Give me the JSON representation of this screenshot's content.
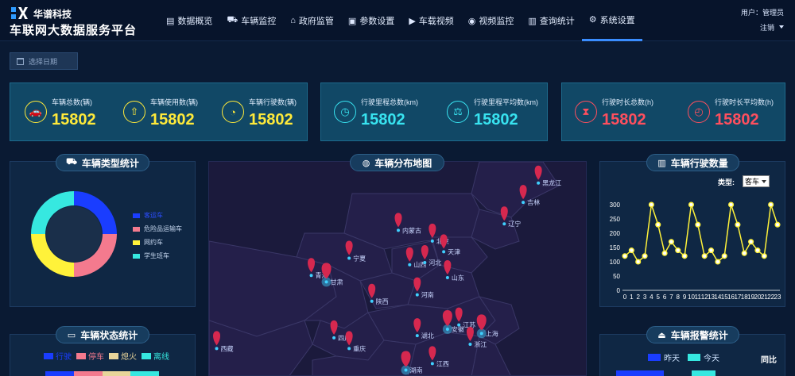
{
  "header": {
    "brand": "华谱科技",
    "title": "车联网大数据服务平台",
    "nav": [
      {
        "label": "数据概览",
        "icon": "list-icon",
        "glyph": "▤"
      },
      {
        "label": "车辆监控",
        "icon": "truck-icon",
        "glyph": "⛟"
      },
      {
        "label": "政府监管",
        "icon": "building-icon",
        "glyph": "⌂"
      },
      {
        "label": "参数设置",
        "icon": "settings-panel-icon",
        "glyph": "▣"
      },
      {
        "label": "车载视频",
        "icon": "video-icon",
        "glyph": "▶"
      },
      {
        "label": "视频监控",
        "icon": "camera-icon",
        "glyph": "◉"
      },
      {
        "label": "查询统计",
        "icon": "bar-chart-icon",
        "glyph": "▥"
      },
      {
        "label": "系统设置",
        "icon": "gear-icon",
        "glyph": "⚙"
      }
    ],
    "active_nav": "系统设置",
    "user": "用户：管理员",
    "logout": "注销"
  },
  "date_picker": {
    "placeholder": "选择日期"
  },
  "stats": [
    {
      "label": "车辆总数(辆)",
      "value": "15802",
      "icon": "car-icon",
      "glyph": "🚗",
      "color": "#ffea3a"
    },
    {
      "label": "车辆使用数(辆)",
      "value": "15802",
      "icon": "upload-icon",
      "glyph": "⇧",
      "color": "#ffea3a"
    },
    {
      "label": "车辆行驶数(辆)",
      "value": "15802",
      "icon": "pie-icon",
      "glyph": "◔",
      "color": "#ffea3a"
    },
    {
      "label": "行驶里程总数(km)",
      "value": "15802",
      "icon": "gauge-icon",
      "glyph": "◷",
      "color": "#38e3f0"
    },
    {
      "label": "行驶里程平均数(km)",
      "value": "15802",
      "icon": "scale-icon",
      "glyph": "⚖",
      "color": "#38e3f0"
    },
    {
      "label": "行驶时长总数(h)",
      "value": "15802",
      "icon": "hourglass-icon",
      "glyph": "⧗",
      "color": "#ff4f5e"
    },
    {
      "label": "行驶时长平均数(h)",
      "value": "15802",
      "icon": "clock-icon",
      "glyph": "◴",
      "color": "#ff4f5e"
    }
  ],
  "panels": {
    "vehicle_type": "车辆类型统计",
    "map": "车辆分布地图",
    "driving": "车辆行驶数量",
    "status": "车辆状态统计",
    "alarm": "车辆报警统计"
  },
  "vehicle_type_chart": {
    "type": "pie",
    "labels": [
      "客运车",
      "危险品运输车",
      "网约车",
      "学生班车"
    ],
    "values": [
      25,
      25,
      25,
      25
    ],
    "colors": [
      "#1a3dff",
      "#f47a8e",
      "#fff23a",
      "#36e8e0"
    ]
  },
  "map": {
    "markers": [
      {
        "name": "黑龙江",
        "x": 0.87,
        "y": 0.01
      },
      {
        "name": "吉林",
        "x": 0.83,
        "y": 0.1
      },
      {
        "name": "辽宁",
        "x": 0.78,
        "y": 0.2
      },
      {
        "name": "内蒙古",
        "x": 0.5,
        "y": 0.23
      },
      {
        "name": "北京",
        "x": 0.59,
        "y": 0.28
      },
      {
        "name": "天津",
        "x": 0.62,
        "y": 0.33
      },
      {
        "name": "宁夏",
        "x": 0.37,
        "y": 0.36
      },
      {
        "name": "山西",
        "x": 0.53,
        "y": 0.39
      },
      {
        "name": "河北",
        "x": 0.57,
        "y": 0.38
      },
      {
        "name": "青海",
        "x": 0.27,
        "y": 0.44
      },
      {
        "name": "甘肃",
        "x": 0.31,
        "y": 0.47
      },
      {
        "name": "山东",
        "x": 0.63,
        "y": 0.45
      },
      {
        "name": "河南",
        "x": 0.55,
        "y": 0.53
      },
      {
        "name": "陕西",
        "x": 0.43,
        "y": 0.56
      },
      {
        "name": "安徽",
        "x": 0.63,
        "y": 0.69
      },
      {
        "name": "江苏",
        "x": 0.66,
        "y": 0.67
      },
      {
        "name": "上海",
        "x": 0.72,
        "y": 0.71
      },
      {
        "name": "湖北",
        "x": 0.55,
        "y": 0.72
      },
      {
        "name": "浙江",
        "x": 0.69,
        "y": 0.76
      },
      {
        "name": "四川",
        "x": 0.33,
        "y": 0.73
      },
      {
        "name": "重庆",
        "x": 0.37,
        "y": 0.78
      },
      {
        "name": "西藏",
        "x": 0.02,
        "y": 0.78
      },
      {
        "name": "湖南",
        "x": 0.52,
        "y": 0.88
      },
      {
        "name": "江西",
        "x": 0.59,
        "y": 0.85
      }
    ],
    "highlighted": [
      "甘肃",
      "安徽",
      "上海",
      "湖南"
    ]
  },
  "driving_chart": {
    "type": "line",
    "select_label": "类型:",
    "select_value": "客车",
    "x": [
      "0",
      "1",
      "2",
      "3",
      "4",
      "5",
      "6",
      "7",
      "8",
      "9",
      "10",
      "11",
      "12",
      "13",
      "14",
      "15",
      "16",
      "17",
      "18",
      "19",
      "20",
      "21",
      "22",
      "23"
    ],
    "values": [
      120,
      140,
      100,
      120,
      300,
      230,
      130,
      170,
      140,
      120,
      300,
      230,
      120,
      140,
      100,
      120,
      300,
      230,
      130,
      170,
      140,
      120,
      300,
      230
    ],
    "ylim": [
      0,
      300
    ],
    "yticks": [
      0,
      50,
      100,
      150,
      200,
      250,
      300
    ],
    "color": "#fff23a"
  },
  "status_legend": [
    {
      "label": "行驶",
      "color": "#1a3dff"
    },
    {
      "label": "停车",
      "color": "#f47a8e"
    },
    {
      "label": "熄火",
      "color": "#e8d59a"
    },
    {
      "label": "离线",
      "color": "#36e8e0"
    }
  ],
  "alarm_legend": [
    {
      "label": "昨天",
      "color": "#1a3dff"
    },
    {
      "label": "今天",
      "color": "#36e8e0"
    }
  ],
  "alarm_compare": "同比"
}
